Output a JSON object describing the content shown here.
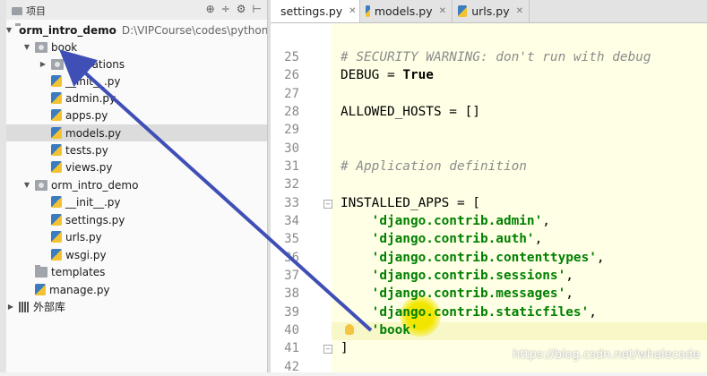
{
  "project_panel": {
    "title": "项目",
    "tools": [
      "⊕",
      "÷",
      "⚙",
      "⊢"
    ],
    "tree": [
      {
        "label": "orm_intro_demo",
        "path": "D:\\VIPCourse\\codes\\python_",
        "bold": true
      },
      {
        "label": "book"
      },
      {
        "label": "migrations"
      },
      {
        "label": "__init__.py"
      },
      {
        "label": "admin.py"
      },
      {
        "label": "apps.py"
      },
      {
        "label": "models.py"
      },
      {
        "label": "tests.py"
      },
      {
        "label": "views.py"
      },
      {
        "label": "orm_intro_demo"
      },
      {
        "label": "__init__.py"
      },
      {
        "label": "settings.py"
      },
      {
        "label": "urls.py"
      },
      {
        "label": "wsgi.py"
      },
      {
        "label": "templates"
      },
      {
        "label": "manage.py"
      },
      {
        "label": "外部库"
      }
    ]
  },
  "tabs": [
    {
      "label": "settings.py",
      "active": true
    },
    {
      "label": "models.py",
      "active": false
    },
    {
      "label": "urls.py",
      "active": false
    }
  ],
  "editor": {
    "lines": [
      {
        "n": "25",
        "t": "# SECURITY WARNING: don't run with debug"
      },
      {
        "n": "26",
        "a": "DEBUG = ",
        "b": "True"
      },
      {
        "n": "27",
        "t": ""
      },
      {
        "n": "28",
        "t": "ALLOWED_HOSTS = []"
      },
      {
        "n": "29",
        "t": ""
      },
      {
        "n": "30",
        "t": ""
      },
      {
        "n": "31",
        "t": "# Application definition"
      },
      {
        "n": "32",
        "t": ""
      },
      {
        "n": "33",
        "t": "INSTALLED_APPS = ["
      },
      {
        "n": "34",
        "s": "'django.contrib.admin'",
        "e": ","
      },
      {
        "n": "35",
        "s": "'django.contrib.auth'",
        "e": ","
      },
      {
        "n": "36",
        "s": "'django.contrib.contenttypes'",
        "e": ","
      },
      {
        "n": "37",
        "s": "'django.contrib.sessions'",
        "e": ","
      },
      {
        "n": "38",
        "s": "'django.contrib.messages'",
        "e": ","
      },
      {
        "n": "39",
        "s": "'django.contrib.staticfiles'",
        "e": ","
      },
      {
        "n": "40",
        "s": "'book'",
        "e": ""
      },
      {
        "n": "41",
        "t": "]"
      },
      {
        "n": "42",
        "t": ""
      }
    ]
  },
  "watermark": "https://blog.csdn.net/whalecode"
}
